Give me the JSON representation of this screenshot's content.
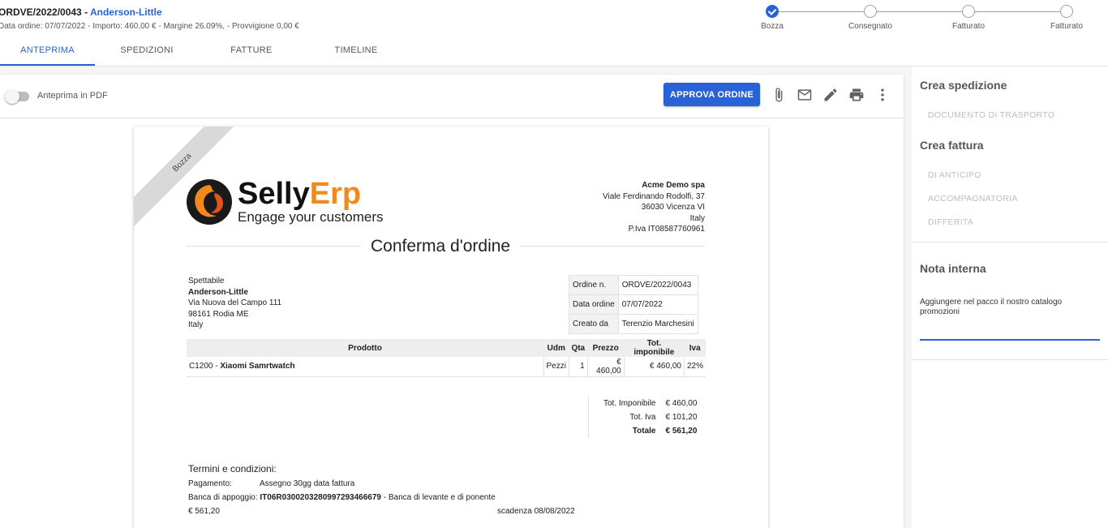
{
  "header": {
    "order_code": "ORDVE/2022/0043 -",
    "customer": "Anderson-Little",
    "subtitle": "Data ordine: 07/07/2022 - Importo: 460,00 € - Margine 26.09%, - Provvigione 0,00 €"
  },
  "steps": [
    {
      "label": "Bozza",
      "done": true
    },
    {
      "label": "Consegnato",
      "done": false
    },
    {
      "label": "Fatturato",
      "done": false
    },
    {
      "label": "Fatturato",
      "done": false
    }
  ],
  "tabs": [
    "ANTEPRIMA",
    "SPEDIZIONI",
    "FATTURE",
    "TIMELINE"
  ],
  "active_tab": "ANTEPRIMA",
  "toolbar": {
    "pdf_toggle_label": "Anteprima in PDF",
    "pdf_toggle_on": false,
    "approve_label": "APPROVA ORDINE",
    "icons": [
      "paperclip-icon",
      "mail-icon",
      "edit-icon",
      "print-icon",
      "more-vert-icon"
    ]
  },
  "colors": {
    "accent": "#2962d6",
    "brand_orange": "#f08a1c"
  },
  "document": {
    "ribbon": "Bozza",
    "logo_main": "Selly",
    "logo_accent": "Erp",
    "logo_tagline": "Engage your customers",
    "company": {
      "name": "Acme Demo spa",
      "address": "Viale Ferdinando Rodolfi, 37",
      "city": "36030 Vicenza VI",
      "country": "Italy",
      "vat": "P.Iva IT08587760961"
    },
    "title": "Conferma d'ordine",
    "recipient": {
      "salutation": "Spettabile",
      "name": "Anderson-Little",
      "address": "Via Nuova del Campo 111",
      "city": "98161 Rodia ME",
      "country": "Italy"
    },
    "info": {
      "order_no_label": "Ordine n.",
      "order_no": "ORDVE/2022/0043",
      "date_label": "Data ordine",
      "date": "07/07/2022",
      "created_by_label": "Creato da",
      "created_by": "Terenzio Marchesini"
    },
    "product_headers": {
      "product": "Prodotto",
      "udm": "Udm",
      "qty": "Qta",
      "price": "Prezzo",
      "taxable": "Tot. imponibile",
      "vat": "Iva"
    },
    "products": [
      {
        "code": "C1200 - ",
        "name": "Xiaomi Samrtwatch",
        "udm": "Pezzi",
        "qty": "1",
        "price": "€ 460,00",
        "taxable": "€ 460,00",
        "vat": "22%"
      }
    ],
    "totals": {
      "taxable_label": "Tot. Imponibile",
      "taxable": "€ 460,00",
      "vat_label": "Tot. Iva",
      "vat": "€ 101,20",
      "total_label": "Totale",
      "total": "€ 561,20"
    },
    "terms": {
      "title": "Termini e condizioni:",
      "payment_label": "Pagamento:",
      "payment": "Assegno 30gg data fattura",
      "bank_label": "Banca di appoggio:",
      "iban": "IT06R0300203280997293466679",
      "bank_name": " - Banca di levante e di ponente",
      "amount": "€ 561,20",
      "due": "scadenza 08/08/2022"
    }
  },
  "side": {
    "shipping_title": "Crea spedizione",
    "shipping_links": [
      "DOCUMENTO DI TRASPORTO"
    ],
    "invoice_title": "Crea fattura",
    "invoice_links": [
      "DI ANTICIPO",
      "ACCOMPAGNATORIA",
      "DIFFERITA"
    ],
    "note_title": "Nota interna",
    "note_text": "Aggiungere nel pacco il nostro catalogo promozioni"
  }
}
